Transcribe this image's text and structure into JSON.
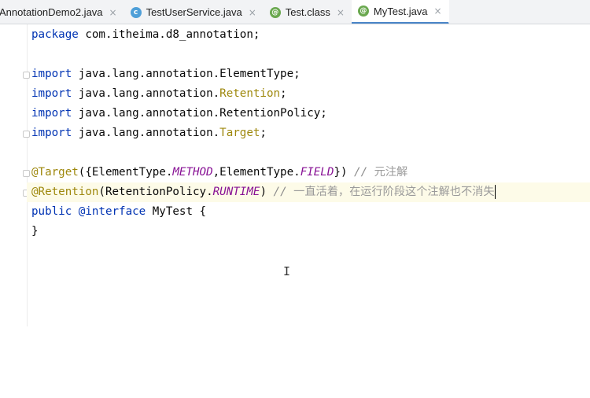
{
  "tabs": [
    {
      "label": "AnnotationDemo2.java",
      "icon": "none",
      "active": false
    },
    {
      "label": "TestUserService.java",
      "icon": "class-icon",
      "active": false
    },
    {
      "label": "Test.class",
      "icon": "annotation-icon",
      "active": false
    },
    {
      "label": "MyTest.java",
      "icon": "annotation-icon",
      "active": true
    }
  ],
  "tab_close_glyph": "×",
  "icon_letters": {
    "class": "c",
    "annotation": "@"
  },
  "code": {
    "package_kw": "package",
    "package_name": " com.itheima.d8_annotation;",
    "imports": [
      {
        "kw": "import",
        "plain": " java.lang.annotation.ElementType;",
        "hl": ""
      },
      {
        "kw": "import",
        "plain": " java.lang.annotation.",
        "hl": "Retention",
        "tail": ";"
      },
      {
        "kw": "import",
        "plain": " java.lang.annotation.RetentionPolicy;",
        "hl": ""
      },
      {
        "kw": "import",
        "plain": " java.lang.annotation.",
        "hl": "Target",
        "tail": ";"
      }
    ],
    "line_target": {
      "anno": "@Target",
      "p1": "({ElementType.",
      "s1": "METHOD",
      "p2": ",ElementType.",
      "s2": "FIELD",
      "p3": "}) ",
      "comment": "// ",
      "comment_cjk": "元注解"
    },
    "line_retention": {
      "anno": "@Retention",
      "p1": "(RetentionPolicy.",
      "s1": "RUNTIME",
      "p2": ") ",
      "comment": "// ",
      "comment_cjk": "一直活着，在运行阶段这个注解也不消失"
    },
    "line_decl": {
      "kw1": "public",
      "kw2": " @interface",
      "name": " MyTest {"
    },
    "line_close": "}"
  },
  "colors": {
    "keyword": "#0033b3",
    "annotation": "#9e880d",
    "static_field": "#871094",
    "comment": "#8c8c8c",
    "active_tab_underline": "#4a86c8"
  }
}
